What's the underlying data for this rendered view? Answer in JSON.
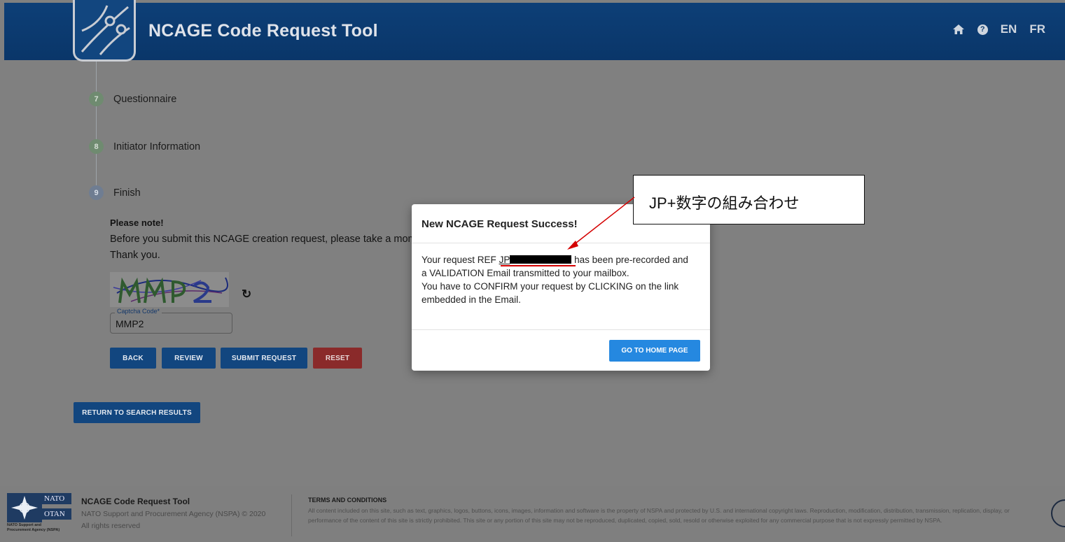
{
  "header": {
    "title": "NCAGE Code Request Tool",
    "lang_en": "EN",
    "lang_fr": "FR",
    "help_glyph": "?",
    "icons": [
      "home-icon",
      "help-icon"
    ]
  },
  "steps": [
    {
      "num": "7",
      "label": "Questionnaire"
    },
    {
      "num": "8",
      "label": "Initiator Information"
    },
    {
      "num": "9",
      "label": "Finish"
    }
  ],
  "finish": {
    "note_title": "Please note!",
    "note_text": "Before you submit this NCAGE creation request, please take a mome",
    "thanks": "Thank you.",
    "captcha_label": "Captcha Code*",
    "captcha_value": "MMP2",
    "refresh_glyph": "↻",
    "buttons": {
      "back": "BACK",
      "review": "REVIEW",
      "submit": "SUBMIT REQUEST",
      "reset": "RESET"
    },
    "return_button": "RETURN TO SEARCH RESULTS"
  },
  "modal": {
    "title": "New NCAGE Request Success!",
    "body_prefix": "Your request REF ",
    "ref_prefix": "JP",
    "body_suffix": " has been pre-recorded and",
    "line2": "a VALIDATION Email transmitted to your mailbox.",
    "line3": "You have to CONFIRM your request by CLICKING on the link",
    "line4": "embedded in the Email.",
    "button": "GO TO HOME PAGE"
  },
  "annotation": {
    "text": "JP+数字の組み合わせ",
    "color": "#d40000"
  },
  "footer": {
    "nato_word1": "NATO",
    "nato_word2": "OTAN",
    "nspa_label": "NATO Support and Procurement Agency (NSPA)",
    "title": "NCAGE Code Request Tool",
    "agency": "NATO Support and Procurement Agency (NSPA) © 2020",
    "rights": "All rights reserved",
    "terms_title": "TERMS AND CONDITIONS",
    "terms_text": "All content included on this site, such as text, graphics, logos, buttons, icons, images, information and software is the property of NSPA and protected by U.S. and international copyright laws. Reproduction, modification, distribution, transmission, replication, display, or performance of the content of this site is strictly prohibited. This site or any portion of this site may not be reproduced, duplicated, copied, sold, resold or otherwise exploited for any commercial purpose that is not expressly permitted by NSPA."
  },
  "colors": {
    "header_bg": "#0b3a6e",
    "overlay_bg": "#808080",
    "primary_button": "#12467f",
    "reset_button": "#8a2a2a",
    "modal_button": "#2588e0"
  }
}
